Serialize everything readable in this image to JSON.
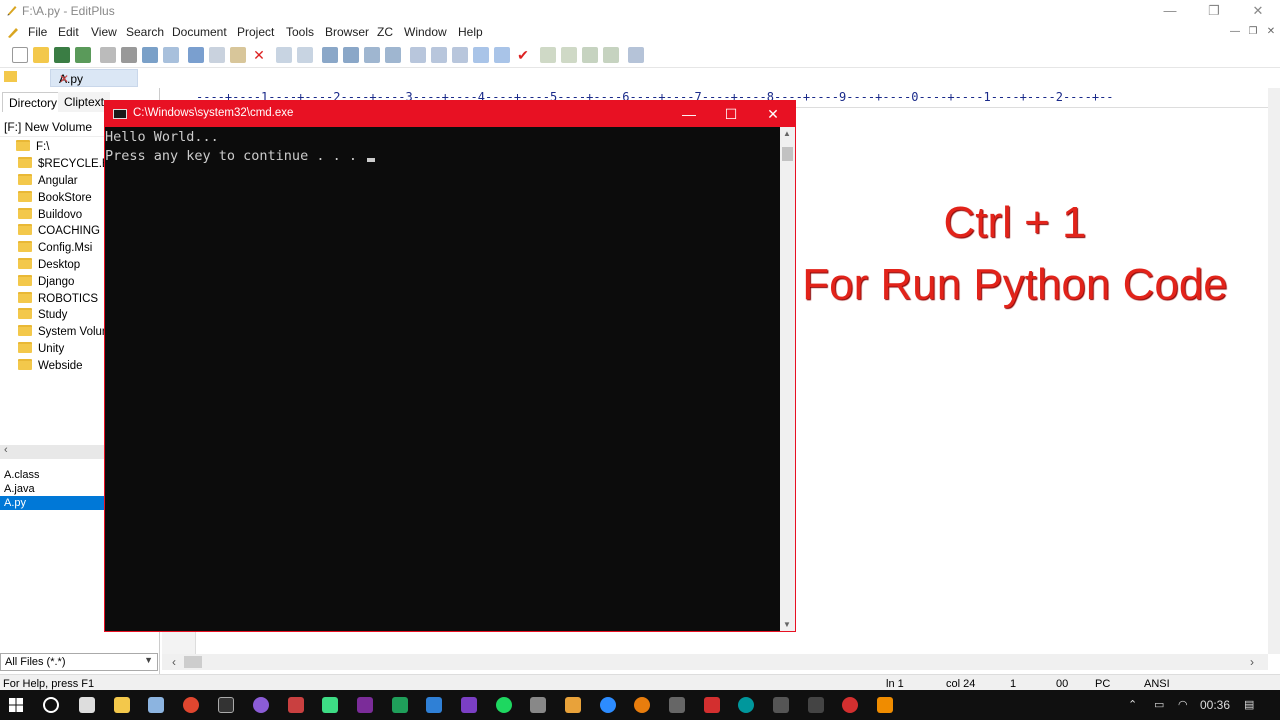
{
  "window": {
    "title": "F:\\A.py - EditPlus",
    "minimize": "—",
    "restore": "❐",
    "close": "✕"
  },
  "menu": [
    "File",
    "Edit",
    "View",
    "Search",
    "Document",
    "Project",
    "Tools",
    "Browser",
    "ZC",
    "Window",
    "Help"
  ],
  "tab": {
    "label": "A.py"
  },
  "panel": {
    "tabs": [
      "Directory",
      "Cliptext"
    ],
    "drive": "[F:] New Volume",
    "root": "F:\\",
    "folders": [
      "$RECYCLE.BIN",
      "Angular",
      "BookStore",
      "Buildovo",
      "COACHING",
      "Config.Msi",
      "Desktop",
      "Django",
      "ROBOTICS",
      "Study",
      "System Volume",
      "Unity",
      "Webside"
    ],
    "files": [
      "A.class",
      "A.java",
      "A.py"
    ],
    "selected_file": "A.py",
    "filter": "All Files (*.*)"
  },
  "ruler": "----+----1----+----2----+----3----+----4----+----5----+----6----+----7----+----8----+----9----+----0----+----1----+----2----+--",
  "overlay": {
    "line1": "Ctrl + 1",
    "line2": "For Run Python Code"
  },
  "cmd": {
    "title": "C:\\Windows\\system32\\cmd.exe",
    "lines": [
      "Hello World...",
      "Press any key to continue . . . "
    ]
  },
  "status": {
    "help": "For Help, press F1",
    "line": "ln 1",
    "col": "col 24",
    "num": "1",
    "zero": "00",
    "mode": "PC",
    "encoding": "ANSI"
  },
  "taskbar": {
    "time": "00:36"
  },
  "colors": {
    "accent_red": "#e81123",
    "overlay_red": "#e2231a",
    "selection": "#0078d7"
  }
}
